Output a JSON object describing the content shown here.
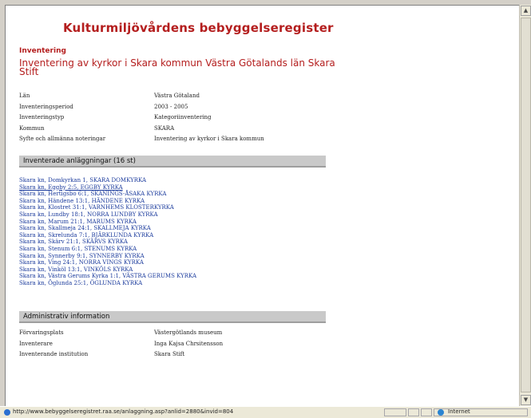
{
  "page": {
    "site_title": "Kulturmiljövårdens bebyggelseregister",
    "section_label": "Inventering",
    "heading": "Inventering av kyrkor i Skara kommun Västra Götalands län Skara Stift"
  },
  "meta": [
    {
      "key": "Län",
      "value": "Västra Götaland"
    },
    {
      "key": "Inventeringsperiod",
      "value": "2003 - 2005"
    },
    {
      "key": "Inventeringstyp",
      "value": "Kategoriinventering"
    },
    {
      "key": "Kommun",
      "value": "SKARA"
    },
    {
      "key": "Syfte och allmänna noteringar",
      "value": "Inventering av kyrkor i Skara kommun"
    }
  ],
  "inventory": {
    "header": "Inventerade anläggningar (16 st)",
    "items": [
      "Skara kn, Domkyrkan 1, SKARA DOMKYRKA",
      "Skara kn, Eggby 2:5, EGGBY KYRKA",
      "Skara kn, Hertigsbo 6:1, SKÄNINGS-ÅSAKA KYRKA",
      "Skara kn, Händene 13:1, HÄNDENE KYRKA",
      "Skara kn, Klostret 31:1, VARNHEMS KLOSTERKYRKA",
      "Skara kn, Lundby 18:1, NORRA LUNDBY KYRKA",
      "Skara kn, Marum 21:1, MARUMS KYRKA",
      "Skara kn, Skallmeja 24:1, SKALLMEJA KYRKA",
      "Skara kn, Skrelunda 7:1, BJÄRKLUNDA KYRKA",
      "Skara kn, Skärv 21:1, SKÄRVS KYRKA",
      "Skara kn, Stenum 6:1, STENUMS KYRKA",
      "Skara kn, Synnerby 9:1, SYNNERBY KYRKA",
      "Skara kn, Ving 24:1, NORRA VINGS KYRKA",
      "Skara kn, Vinköl 13:1, VINKÖLS KYRKA",
      "Skara kn, Västra Gerums Kyrka 1:1, VÄSTRA GERUMS KYRKA",
      "Skara kn, Öglunda 25:1, ÖGLUNDA KYRKA"
    ]
  },
  "admin": {
    "header": "Administrativ information",
    "rows": [
      {
        "key": "Förvaringsplats",
        "value": "Västergötlands museum"
      },
      {
        "key": "Inventerare",
        "value": "Inga Kajsa Chrsitensson"
      },
      {
        "key": "Inventerande institution",
        "value": "Skara Stift"
      }
    ]
  },
  "statusbar": {
    "url": "http://www.bebyggelseregistret.raa.se/anlaggning.asp?anlid=2880&invid=804",
    "zone": "Internet"
  },
  "icons": {
    "page": "ie-page-icon",
    "zone": "globe-icon"
  }
}
